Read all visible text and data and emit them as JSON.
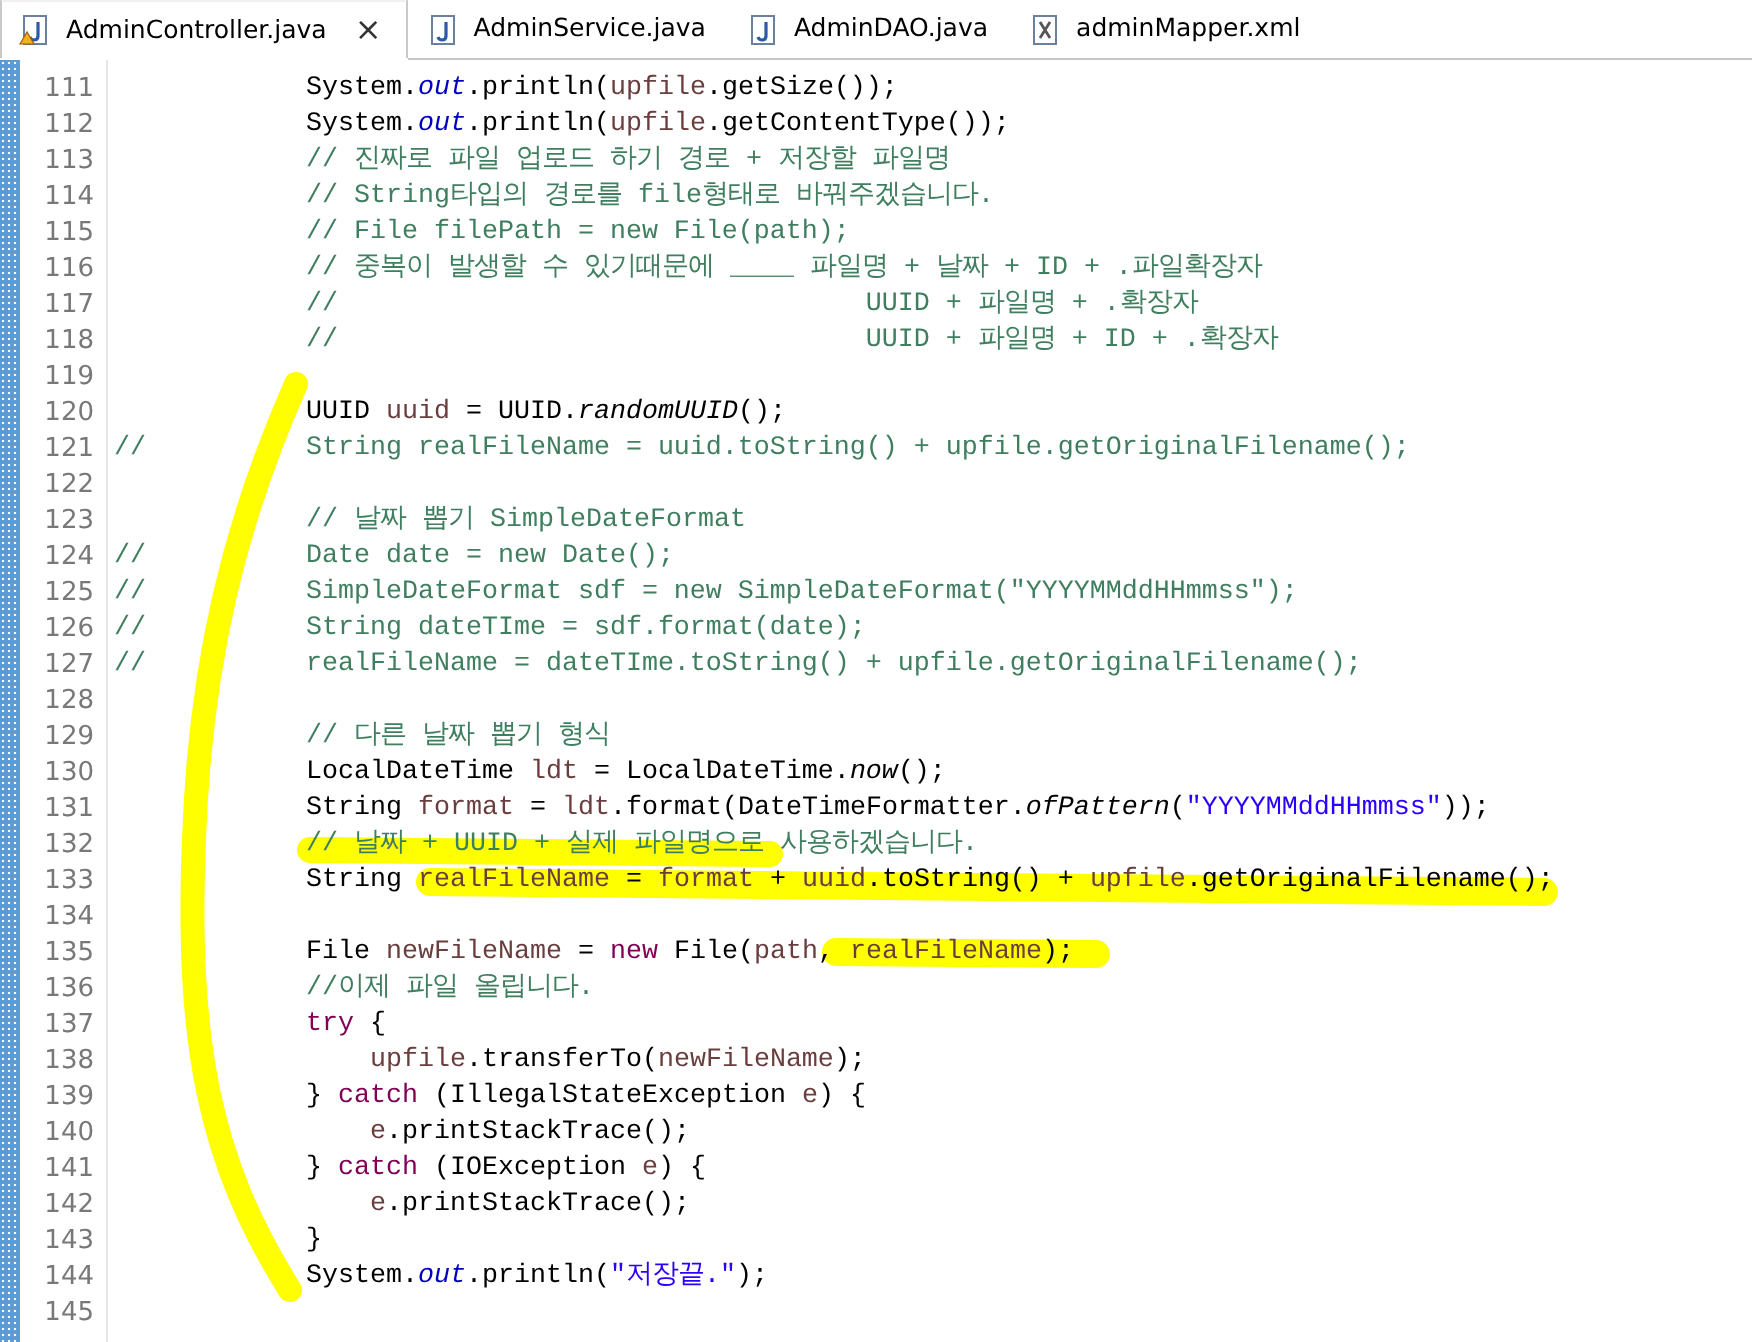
{
  "tabs": [
    {
      "label": "AdminController.java",
      "selected": true,
      "kind": "java",
      "warning": true,
      "closable": true
    },
    {
      "label": "AdminService.java",
      "selected": false,
      "kind": "java",
      "warning": false,
      "closable": false
    },
    {
      "label": "AdminDAO.java",
      "selected": false,
      "kind": "java",
      "warning": false,
      "closable": false
    },
    {
      "label": "adminMapper.xml",
      "selected": false,
      "kind": "xml",
      "warning": false,
      "closable": false
    }
  ],
  "close_glyph": "×",
  "editor": {
    "lines": [
      {
        "number": "111",
        "tokens": [
          {
            "kind": "plain",
            "text": "            System."
          },
          {
            "kind": "field",
            "text": "out"
          },
          {
            "kind": "plain",
            "text": ".println("
          },
          {
            "kind": "local",
            "text": "upfile"
          },
          {
            "kind": "plain",
            "text": ".getSize());"
          }
        ]
      },
      {
        "number": "112",
        "tokens": [
          {
            "kind": "plain",
            "text": "            System."
          },
          {
            "kind": "field",
            "text": "out"
          },
          {
            "kind": "plain",
            "text": ".println("
          },
          {
            "kind": "local",
            "text": "upfile"
          },
          {
            "kind": "plain",
            "text": ".getContentType());"
          }
        ]
      },
      {
        "number": "113",
        "tokens": [
          {
            "kind": "comment",
            "text": "            // 진짜로 파일 업로드 하기 경로 + 저장할 파일명"
          }
        ]
      },
      {
        "number": "114",
        "tokens": [
          {
            "kind": "comment",
            "text": "            // String타입의 경로를 file형태로 바꿔주겠습니다."
          }
        ]
      },
      {
        "number": "115",
        "tokens": [
          {
            "kind": "comment",
            "text": "            // File filePath = new File(path);"
          }
        ]
      },
      {
        "number": "116",
        "tokens": [
          {
            "kind": "comment",
            "text": "            // 중복이 발생할 수 있기때문에 ____ 파일명 + 날짜 + ID + .파일확장자"
          }
        ]
      },
      {
        "number": "117",
        "tokens": [
          {
            "kind": "comment",
            "text": "            //                                 UUID + 파일명 + .확장자"
          }
        ]
      },
      {
        "number": "118",
        "tokens": [
          {
            "kind": "comment",
            "text": "            //                                 UUID + 파일명 + ID + .확장자"
          }
        ]
      },
      {
        "number": "119"
      },
      {
        "number": "120",
        "tokens": [
          {
            "kind": "plain",
            "text": "            UUID "
          },
          {
            "kind": "local",
            "text": "uuid"
          },
          {
            "kind": "plain",
            "text": " = UUID."
          },
          {
            "kind": "static",
            "text": "randomUUID"
          },
          {
            "kind": "plain",
            "text": "();"
          }
        ]
      },
      {
        "number": "121",
        "tokens": [
          {
            "kind": "comment",
            "text": "//          String realFileName = uuid.toString() + upfile.getOriginalFilename();"
          }
        ]
      },
      {
        "number": "122"
      },
      {
        "number": "123",
        "tokens": [
          {
            "kind": "comment",
            "text": "            // 날짜 뽑기 SimpleDateFormat"
          }
        ]
      },
      {
        "number": "124",
        "tokens": [
          {
            "kind": "comment",
            "text": "//          Date date = new Date();"
          }
        ]
      },
      {
        "number": "125",
        "tokens": [
          {
            "kind": "comment",
            "text": "//          SimpleDateFormat sdf = new SimpleDateFormat(\"YYYYMMddHHmmss\");"
          }
        ]
      },
      {
        "number": "126",
        "tokens": [
          {
            "kind": "comment",
            "text": "//          String dateTIme = sdf.format(date);"
          }
        ]
      },
      {
        "number": "127",
        "tokens": [
          {
            "kind": "comment",
            "text": "//          realFileName = dateTIme.toString() + upfile.getOriginalFilename();"
          }
        ]
      },
      {
        "number": "128"
      },
      {
        "number": "129",
        "tokens": [
          {
            "kind": "comment",
            "text": "            // 다른 날짜 뽑기 형식"
          }
        ]
      },
      {
        "number": "130",
        "tokens": [
          {
            "kind": "plain",
            "text": "            LocalDateTime "
          },
          {
            "kind": "local",
            "text": "ldt"
          },
          {
            "kind": "plain",
            "text": " = LocalDateTime."
          },
          {
            "kind": "static",
            "text": "now"
          },
          {
            "kind": "plain",
            "text": "();"
          }
        ]
      },
      {
        "number": "131",
        "tokens": [
          {
            "kind": "plain",
            "text": "            String "
          },
          {
            "kind": "local",
            "text": "format"
          },
          {
            "kind": "plain",
            "text": " = "
          },
          {
            "kind": "local",
            "text": "ldt"
          },
          {
            "kind": "plain",
            "text": ".format(DateTimeFormatter."
          },
          {
            "kind": "static",
            "text": "ofPattern"
          },
          {
            "kind": "plain",
            "text": "("
          },
          {
            "kind": "string",
            "text": "\"YYYYMMddHHmmss\""
          },
          {
            "kind": "plain",
            "text": "));"
          }
        ]
      },
      {
        "number": "132",
        "tokens": [
          {
            "kind": "comment",
            "text": "            // 날짜 + UUID + 실제 파일명으로 사용하겠습니다."
          }
        ]
      },
      {
        "number": "133",
        "tokens": [
          {
            "kind": "plain",
            "text": "            String "
          },
          {
            "kind": "local",
            "text": "realFileName"
          },
          {
            "kind": "plain",
            "text": " = "
          },
          {
            "kind": "local",
            "text": "format"
          },
          {
            "kind": "plain",
            "text": " + "
          },
          {
            "kind": "local",
            "text": "uuid"
          },
          {
            "kind": "plain",
            "text": ".toString() + "
          },
          {
            "kind": "local",
            "text": "upfile"
          },
          {
            "kind": "plain",
            "text": ".getOriginalFilename();"
          }
        ]
      },
      {
        "number": "134"
      },
      {
        "number": "135",
        "tokens": [
          {
            "kind": "plain",
            "text": "            File "
          },
          {
            "kind": "local",
            "text": "newFileName"
          },
          {
            "kind": "plain",
            "text": " = "
          },
          {
            "kind": "keyword",
            "text": "new"
          },
          {
            "kind": "plain",
            "text": " File("
          },
          {
            "kind": "local",
            "text": "path"
          },
          {
            "kind": "plain",
            "text": ", "
          },
          {
            "kind": "local",
            "text": "realFileName"
          },
          {
            "kind": "plain",
            "text": ");"
          }
        ]
      },
      {
        "number": "136",
        "tokens": [
          {
            "kind": "comment",
            "text": "            //이제 파일 올립니다."
          }
        ]
      },
      {
        "number": "137",
        "tokens": [
          {
            "kind": "keyword",
            "text": "            try"
          },
          {
            "kind": "plain",
            "text": " {"
          }
        ]
      },
      {
        "number": "138",
        "tokens": [
          {
            "kind": "local",
            "text": "                upfile"
          },
          {
            "kind": "plain",
            "text": ".transferTo("
          },
          {
            "kind": "local",
            "text": "newFileName"
          },
          {
            "kind": "plain",
            "text": ");"
          }
        ]
      },
      {
        "number": "139",
        "tokens": [
          {
            "kind": "plain",
            "text": "            } "
          },
          {
            "kind": "keyword",
            "text": "catch"
          },
          {
            "kind": "plain",
            "text": " (IllegalStateException "
          },
          {
            "kind": "local",
            "text": "e"
          },
          {
            "kind": "plain",
            "text": ") {"
          }
        ]
      },
      {
        "number": "140",
        "tokens": [
          {
            "kind": "local",
            "text": "                e"
          },
          {
            "kind": "plain",
            "text": ".printStackTrace();"
          }
        ]
      },
      {
        "number": "141",
        "tokens": [
          {
            "kind": "plain",
            "text": "            } "
          },
          {
            "kind": "keyword",
            "text": "catch"
          },
          {
            "kind": "plain",
            "text": " (IOException "
          },
          {
            "kind": "local",
            "text": "e"
          },
          {
            "kind": "plain",
            "text": ") {"
          }
        ]
      },
      {
        "number": "142",
        "tokens": [
          {
            "kind": "local",
            "text": "                e"
          },
          {
            "kind": "plain",
            "text": ".printStackTrace();"
          }
        ]
      },
      {
        "number": "143",
        "tokens": [
          {
            "kind": "plain",
            "text": "            }"
          }
        ]
      },
      {
        "number": "144",
        "tokens": [
          {
            "kind": "plain",
            "text": "            System."
          },
          {
            "kind": "field",
            "text": "out"
          },
          {
            "kind": "plain",
            "text": ".println("
          },
          {
            "kind": "string",
            "text": "\"저장끝.\""
          },
          {
            "kind": "plain",
            "text": ");"
          }
        ]
      },
      {
        "number": "145"
      }
    ]
  }
}
